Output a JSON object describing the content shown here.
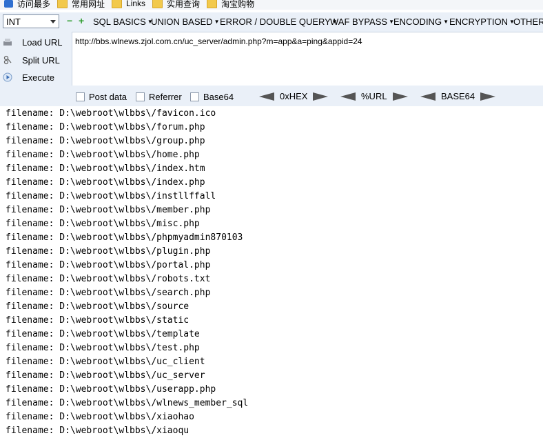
{
  "bookmarks": [
    {
      "label": "访问最多",
      "icon": "site-icon"
    },
    {
      "label": "常用网址",
      "icon": "folder-icon"
    },
    {
      "label": "Links",
      "icon": "folder-icon"
    },
    {
      "label": "实用查询",
      "icon": "folder-icon"
    },
    {
      "label": "淘宝购物",
      "icon": "folder-icon"
    }
  ],
  "toolbar": {
    "select_value": "INT",
    "minus": "−",
    "plus": "+",
    "menus": [
      "SQL BASICS",
      "UNION BASED",
      "ERROR / DOUBLE QUERY",
      "WAF BYPASS",
      "ENCODING",
      "ENCRYPTION",
      "OTHER"
    ]
  },
  "side": {
    "load": "Load URL",
    "split": "Split URL",
    "execute": "Execute"
  },
  "url": "http://bbs.wlnews.zjol.com.cn/uc_server/admin.php?m=app&a=ping&appid=24",
  "options": {
    "post": "Post data",
    "referrer": "Referrer",
    "base64": "Base64",
    "hex": "0xHEX",
    "urlenc": "%URL",
    "b64enc": "BASE64"
  },
  "output_lines": [
    "filename: D:\\webroot\\wlbbs\\/favicon.ico",
    "filename: D:\\webroot\\wlbbs\\/forum.php",
    "filename: D:\\webroot\\wlbbs\\/group.php",
    "filename: D:\\webroot\\wlbbs\\/home.php",
    "filename: D:\\webroot\\wlbbs\\/index.htm",
    "filename: D:\\webroot\\wlbbs\\/index.php",
    "filename: D:\\webroot\\wlbbs\\/instllffall",
    "filename: D:\\webroot\\wlbbs\\/member.php",
    "filename: D:\\webroot\\wlbbs\\/misc.php",
    "filename: D:\\webroot\\wlbbs\\/phpmyadmin870103",
    "filename: D:\\webroot\\wlbbs\\/plugin.php",
    "filename: D:\\webroot\\wlbbs\\/portal.php",
    "filename: D:\\webroot\\wlbbs\\/robots.txt",
    "filename: D:\\webroot\\wlbbs\\/search.php",
    "filename: D:\\webroot\\wlbbs\\/source",
    "filename: D:\\webroot\\wlbbs\\/static",
    "filename: D:\\webroot\\wlbbs\\/template",
    "filename: D:\\webroot\\wlbbs\\/test.php",
    "filename: D:\\webroot\\wlbbs\\/uc_client",
    "filename: D:\\webroot\\wlbbs\\/uc_server",
    "filename: D:\\webroot\\wlbbs\\/userapp.php",
    "filename: D:\\webroot\\wlbbs\\/wlnews_member_sql",
    "filename: D:\\webroot\\wlbbs\\/xiaohao",
    "filename: D:\\webroot\\wlbbs\\/xiaoqu"
  ]
}
